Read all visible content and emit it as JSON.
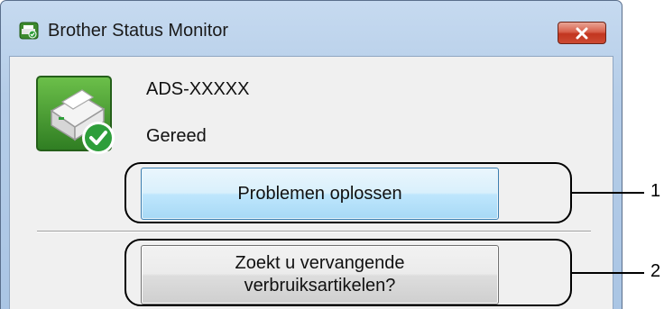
{
  "window": {
    "title": "Brother Status Monitor",
    "close_icon": "close-icon"
  },
  "device": {
    "icon": "printer-ready-icon",
    "name": "ADS-XXXXX",
    "status": "Gereed"
  },
  "buttons": {
    "troubleshoot_label": "Problemen oplossen",
    "supplies_line1": "Zoekt u vervangende",
    "supplies_line2": "verbruiksartikelen?"
  },
  "callouts": {
    "one": "1",
    "two": "2"
  },
  "colors": {
    "status_ok": "#2e9e3a",
    "close_button": "#c2351f",
    "active_button_border": "#3c7fb1"
  }
}
